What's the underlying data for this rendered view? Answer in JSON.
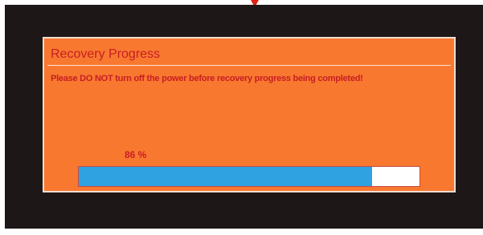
{
  "dialog": {
    "title": "Recovery Progress",
    "message": "Please DO NOT turn off the power before recovery progress being completed!",
    "progress": {
      "percent_label": "86 %",
      "value": 0.86
    }
  },
  "colors": {
    "screen_background": "#1e1717",
    "dialog_background": "#f87830",
    "text_red": "#c81e22",
    "progress_fill": "#2fa2e2",
    "progress_track": "#ffffff"
  },
  "icons": {
    "top_indicator": "down-arrow-indicator-icon"
  }
}
